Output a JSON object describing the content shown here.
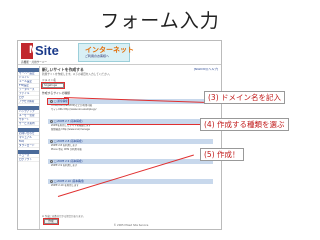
{
  "slide": {
    "title": "フォーム入力"
  },
  "screenshot": {
    "brand": {
      "logo": "Site",
      "logo_sub": "高機能・共用サーバー",
      "banner": "インターネット",
      "banner_sub": "ご利用のお客様へ"
    },
    "sidebar": {
      "items": [
        "サーバー設定",
        "ドメイン",
        "メール設定",
        "FTP設定",
        "データベース",
        "ファイル",
        "ログ",
        "アクセス解析",
        "バックアップ",
        "ユーザー管理",
        "サポート",
        "サービス案内",
        "お問い合わせ",
        "マニュアル",
        "FAQ",
        "ダウンロード",
        "ニュース",
        "ログアウト"
      ]
    },
    "main": {
      "page_title": "新しいサイトを作成する",
      "help": "[SIGN IN] [ヘルプ]",
      "description": "新規サイトを作成します。以下の項目を入力してください。",
      "domain_label": "ドメイン名",
      "domain_value": "hogehoge",
      "type_label": "作成するサイトの種類",
      "sections": [
        {
          "title": "□ 通常構成",
          "rows": [
            "HTML/CGI (Perl/PHP)などが利用可能",
            "サイトURL http://www.xxx.example.jp/"
          ]
        },
        {
          "title": "□ ZOPE 2.7 (基本構成)",
          "rows": [
            "ZOPEを利用したサイトを構築します",
            "管理画面 http://www.xxx/manage"
          ]
        },
        {
          "title": "□ ZOPE 2.8 (基本構成)",
          "rows": [
            "ZOPE 2.8 を利用します",
            "Plone 等の CMS が利用可能"
          ]
        },
        {
          "title": "□ ZOPE 2.9 (基本構成)",
          "rows": [
            "ZOPE 2.9 を利用します"
          ]
        },
        {
          "title": "□ ZOPE 2.10 (基本構成)",
          "rows": [
            "ZOPE 2.10 を利用します"
          ]
        }
      ],
      "note": "※ 作成には数分かかる場合があります。",
      "submit": "作成"
    },
    "footer": "© 2005 Mixed Site Service"
  },
  "callouts": {
    "step3": "(3) ドメイン名を記入",
    "step4": "(4) 作成する種類を選ぶ",
    "step5": "(5) 作成！"
  },
  "colors": {
    "callout_text": "#c01818",
    "highlight_box": "#e03030",
    "section_header": "#c8d8ec",
    "logo_red": "#c1272d",
    "logo_blue": "#1a3a8a"
  }
}
